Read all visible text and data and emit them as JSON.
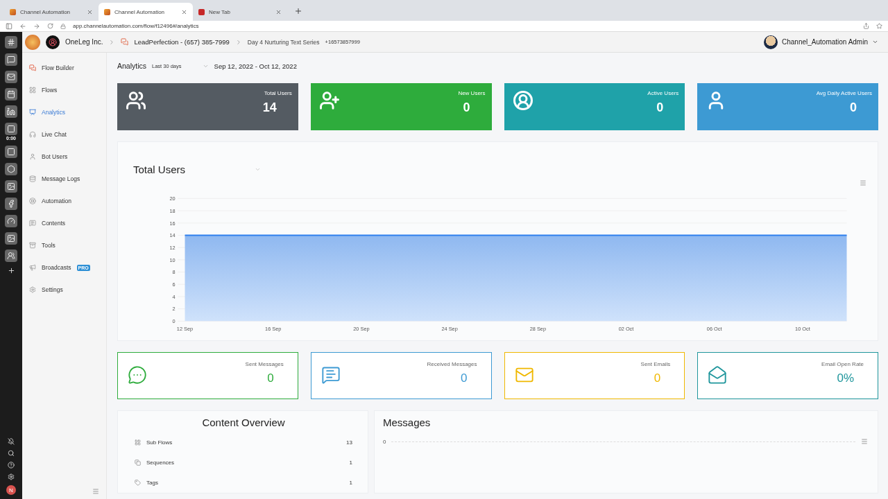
{
  "browser": {
    "tabs": [
      {
        "title": "Channel Automation",
        "selected": false,
        "kind": "app"
      },
      {
        "title": "Channel Automation",
        "selected": true,
        "kind": "app"
      },
      {
        "title": "New Tab",
        "selected": false,
        "kind": "new"
      }
    ],
    "url": "app.channelautomation.com/flow/f12496#/analytics"
  },
  "dock": {
    "timer": "0:00",
    "avatar": "N"
  },
  "header": {
    "org": "OneLeg Inc.",
    "channel": "LeadPerfection - (657) 385-7999",
    "flow": "Day 4 Nurturing Text Series",
    "phone": "+16573857999",
    "user": "Channel_Automation Admin"
  },
  "sidebar": {
    "items": [
      {
        "label": "Flow Builder",
        "selected": false
      },
      {
        "label": "Flows",
        "selected": false
      },
      {
        "label": "Analytics",
        "selected": true
      },
      {
        "label": "Live Chat",
        "selected": false
      },
      {
        "label": "Bot Users",
        "selected": false
      },
      {
        "label": "Message Logs",
        "selected": false
      },
      {
        "label": "Automation",
        "selected": false
      },
      {
        "label": "Contents",
        "selected": false
      },
      {
        "label": "Tools",
        "selected": false
      },
      {
        "label": "Broadcasts",
        "selected": false,
        "badge": "PRO"
      },
      {
        "label": "Settings",
        "selected": false
      }
    ]
  },
  "analytics": {
    "title": "Analytics",
    "range": "Last 30 days",
    "dates": "Sep 12, 2022 - Oct 12, 2022"
  },
  "stat_cards": [
    {
      "label": "Total Users",
      "value": "14",
      "color": "#545b62"
    },
    {
      "label": "New Users",
      "value": "0",
      "color": "#2eac3c"
    },
    {
      "label": "Active Users",
      "value": "0",
      "color": "#1fa2a9"
    },
    {
      "label": "Avg Daily Active Users",
      "value": "0",
      "color": "#3d9ad3"
    }
  ],
  "total_users_chart": {
    "title": "Total Users",
    "chart_data": {
      "type": "area",
      "categories": [
        "12 Sep",
        null,
        null,
        null,
        "16 Sep",
        null,
        null,
        null,
        "20 Sep",
        null,
        null,
        null,
        "24 Sep",
        null,
        null,
        null,
        "28 Sep",
        null,
        null,
        null,
        "02 Oct",
        null,
        null,
        null,
        "06 Oct",
        null,
        null,
        null,
        "10 Oct",
        null,
        null
      ],
      "series": [
        {
          "color": "#2f80ed",
          "values": [
            14,
            14,
            14,
            14,
            14,
            14,
            14,
            14,
            14,
            14,
            14,
            14,
            14,
            14,
            14,
            14,
            14,
            14,
            14,
            14,
            14,
            14,
            14,
            14,
            14,
            14,
            14,
            14,
            14,
            14,
            14
          ]
        }
      ],
      "grid": true,
      "ylim": [
        0,
        20
      ],
      "yticks": [
        0,
        2,
        4,
        6,
        8,
        10,
        12,
        14,
        16,
        18,
        20
      ]
    }
  },
  "message_cards": [
    {
      "label": "Sent Messages",
      "value": "0",
      "color": "#2eac3c"
    },
    {
      "label": "Received Messages",
      "value": "0",
      "color": "#3d9ad3"
    },
    {
      "label": "Sent Emails",
      "value": "0",
      "color": "#f0b800"
    },
    {
      "label": "Email Open Rate",
      "value": "0%",
      "color": "#1f969c"
    }
  ],
  "content_overview": {
    "title": "Content Overview",
    "items": [
      {
        "label": "Sub Flows",
        "count": "13"
      },
      {
        "label": "Sequences",
        "count": "1"
      },
      {
        "label": "Tags",
        "count": "1"
      }
    ]
  },
  "messages": {
    "title": "Messages",
    "y_tick": "0"
  }
}
